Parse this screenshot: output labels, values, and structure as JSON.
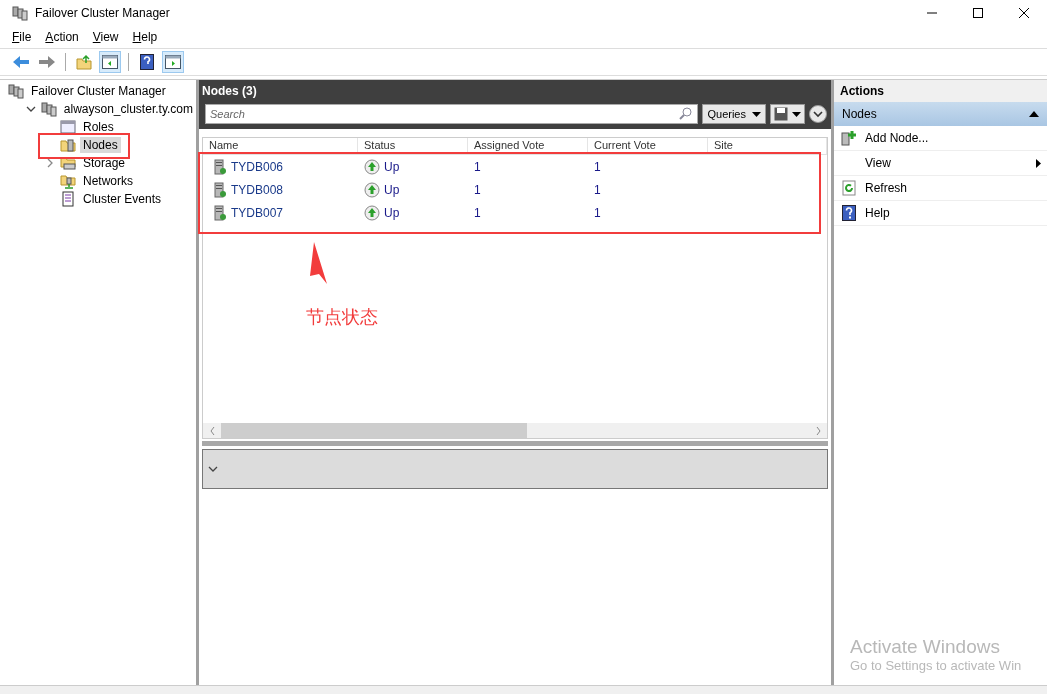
{
  "window": {
    "title": "Failover Cluster Manager"
  },
  "menu": [
    {
      "label": "File"
    },
    {
      "label": "Action"
    },
    {
      "label": "View"
    },
    {
      "label": "Help"
    }
  ],
  "tree": [
    {
      "label": "Failover Cluster Manager",
      "selected": false,
      "children": [
        {
          "label": "alwayson_cluster.ty.com",
          "selected": false,
          "expanded": true,
          "children": [
            {
              "label": "Roles",
              "selected": false
            },
            {
              "label": "Nodes",
              "selected": true
            },
            {
              "label": "Storage",
              "selected": false,
              "expanded": false
            },
            {
              "label": "Networks",
              "selected": false
            },
            {
              "label": "Cluster Events",
              "selected": false
            }
          ]
        }
      ]
    }
  ],
  "center": {
    "title": "Nodes (3)",
    "search": {
      "placeholder": "Search"
    },
    "queries": "Queries",
    "columns": [
      "Name",
      "Status",
      "Assigned Vote",
      "Current Vote",
      "Site"
    ],
    "rows": [
      {
        "name": "TYDB006",
        "status": "Up",
        "assigned_vote": "1",
        "current_vote": "1"
      },
      {
        "name": "TYDB008",
        "status": "Up",
        "assigned_vote": "1",
        "current_vote": "1"
      },
      {
        "name": "TYDB007",
        "status": "Up",
        "assigned_vote": "1",
        "current_vote": "1"
      }
    ]
  },
  "actions": {
    "title": "Actions",
    "section": {
      "label": "Nodes",
      "expanded": true
    },
    "items": [
      {
        "label": "Add Node...",
        "kind": "add"
      },
      {
        "label": "View",
        "kind": "submenu"
      },
      {
        "label": "Refresh",
        "kind": "refresh"
      },
      {
        "label": "Help",
        "kind": "help"
      }
    ]
  },
  "annotation": {
    "label": "节点状态"
  },
  "activation": {
    "title": "Activate Windows",
    "message": "Go to Settings to activate Win"
  }
}
